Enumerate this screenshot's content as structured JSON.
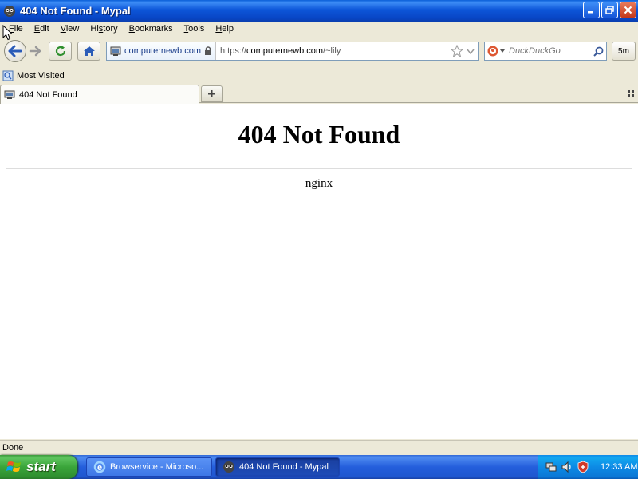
{
  "window": {
    "title": "404 Not Found - Mypal"
  },
  "menubar": {
    "items": [
      {
        "pre": "",
        "u": "F",
        "post": "ile"
      },
      {
        "pre": "",
        "u": "E",
        "post": "dit"
      },
      {
        "pre": "",
        "u": "V",
        "post": "iew"
      },
      {
        "pre": "Hi",
        "u": "s",
        "post": "tory"
      },
      {
        "pre": "",
        "u": "B",
        "post": "ookmarks"
      },
      {
        "pre": "",
        "u": "T",
        "post": "ools"
      },
      {
        "pre": "",
        "u": "H",
        "post": "elp"
      }
    ]
  },
  "navbar": {
    "identity_host": "computernewb.com",
    "url_scheme": "https://",
    "url_domain": "computernewb.com",
    "url_path": "/~lily",
    "search_placeholder": "DuckDuckGo",
    "addon_label": "5m"
  },
  "bookmarks": {
    "most_visited": "Most Visited"
  },
  "tabs": [
    {
      "label": "404 Not Found"
    }
  ],
  "content": {
    "heading": "404 Not Found",
    "server": "nginx"
  },
  "status": {
    "text": "Done"
  },
  "taskbar": {
    "start_label": "start",
    "tasks": [
      {
        "label": "Browservice - Microso..."
      },
      {
        "label": "404 Not Found - Mypal"
      }
    ],
    "clock": "12:33 AM"
  },
  "colors": {
    "title_bar": "#0d56d9",
    "taskbar": "#245edc",
    "start_button": "#3aa53a",
    "tray": "#0d8ae5"
  }
}
